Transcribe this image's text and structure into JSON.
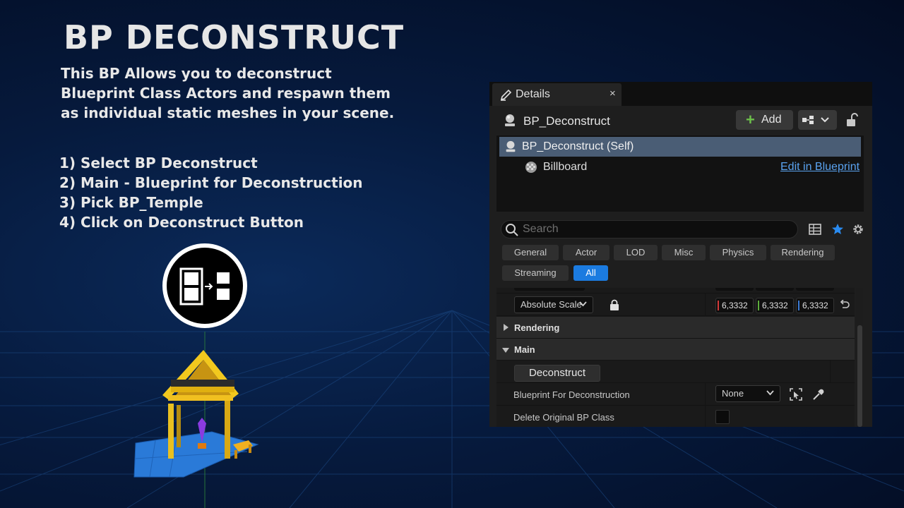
{
  "slide": {
    "title": "BP DECONSTRUCT",
    "description_lines": [
      "This BP Allows you to deconstruct",
      "Blueprint Class Actors and respawn them",
      "as individual static meshes in your scene."
    ],
    "steps": [
      "1) Select BP Deconstruct",
      "2) Main - Blueprint for Deconstruction",
      "3) Pick BP_Temple",
      "4) Click on Deconstruct Button"
    ]
  },
  "details": {
    "tab": {
      "label": "Details",
      "close": "×"
    },
    "actor_name": "BP_Deconstruct",
    "add_label": "Add",
    "components": {
      "root": "BP_Deconstruct (Self)",
      "child": "Billboard",
      "edit_link": "Edit in Blueprint"
    },
    "search": {
      "placeholder": "Search"
    },
    "filters": [
      "General",
      "Actor",
      "LOD",
      "Misc",
      "Physics",
      "Rendering",
      "Streaming",
      "All"
    ],
    "active_filter": "All",
    "properties": {
      "scale_dropdown": "Absolute Scale",
      "scale_values": [
        "6,3332",
        "6,3332",
        "6,3332"
      ],
      "section_rendering": "Rendering",
      "section_main": "Main",
      "deconstruct_button": "Deconstruct",
      "blueprint_label": "Blueprint For Deconstruction",
      "blueprint_value": "None",
      "delete_label": "Delete Original BP Class"
    }
  },
  "colors": {
    "accent": "#1b7be0",
    "selection": "#4a5d75",
    "add_plus": "#6cc04a",
    "axis_x": "#d43a3a",
    "axis_y": "#5dae3c",
    "axis_z": "#3a7ad4"
  }
}
